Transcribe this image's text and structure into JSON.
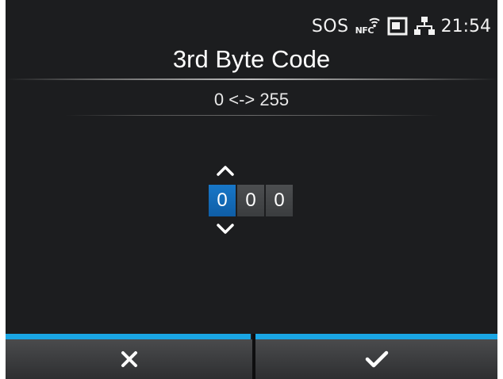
{
  "status_bar": {
    "sos_label": "SOS",
    "nfc_label": "NFC",
    "wifi_icon": "wifi-icon",
    "sd_card_icon": "sd-card-icon",
    "network_icon": "network-icon",
    "time": "21:54"
  },
  "header": {
    "title": "3rd Byte Code",
    "range_text": "0 <-> 255"
  },
  "spinner": {
    "digits": [
      "0",
      "0",
      "0"
    ],
    "selected_index": 0,
    "up_icon": "chevron-up-icon",
    "down_icon": "chevron-down-icon"
  },
  "buttons": {
    "cancel_icon": "close-icon",
    "confirm_icon": "checkmark-icon"
  },
  "colors": {
    "background": "#1c1d1f",
    "accent": "#1aa6e4",
    "selected_digit": "#1877c8",
    "digit": "#45474a",
    "text": "#ffffff"
  }
}
